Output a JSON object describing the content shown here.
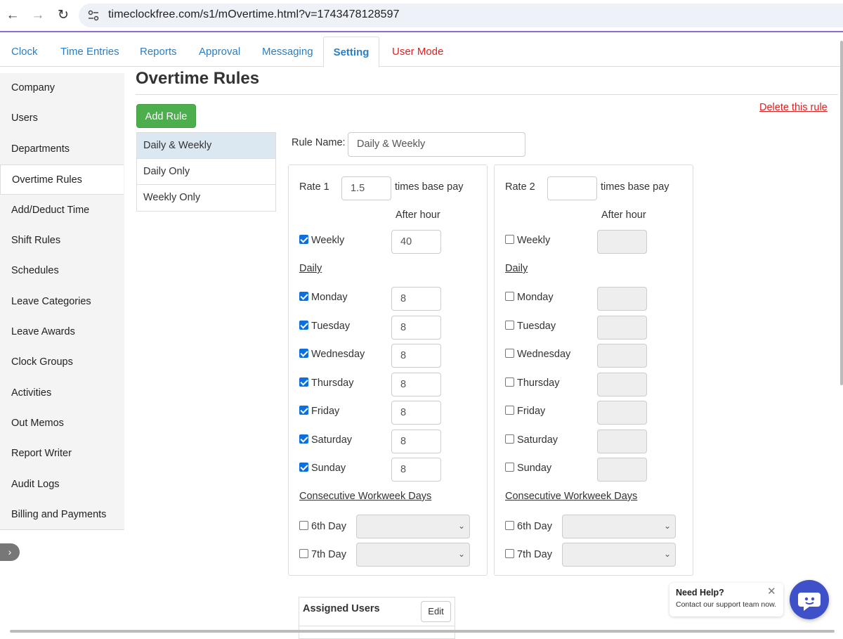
{
  "browser": {
    "url": "timeclockfree.com/s1/mOvertime.html?v=1743478128597"
  },
  "tabs": [
    "Clock",
    "Time Entries",
    "Reports",
    "Approval",
    "Messaging",
    "Setting",
    "User Mode"
  ],
  "sidebar": {
    "items": [
      "Company",
      "Users",
      "Departments",
      "Overtime Rules",
      "Add/Deduct Time",
      "Shift Rules",
      "Schedules",
      "Leave Categories",
      "Leave Awards",
      "Clock Groups",
      "Activities",
      "Out Memos",
      "Report Writer",
      "Audit Logs",
      "Billing and Payments"
    ],
    "active": "Overtime Rules"
  },
  "main": {
    "title": "Overtime Rules",
    "add_rule": "Add Rule",
    "delete_rule": "Delete this rule",
    "rules": [
      "Daily & Weekly",
      "Daily Only",
      "Weekly Only"
    ],
    "rule_name_label": "Rule Name:",
    "rule_name_value": "Daily & Weekly"
  },
  "rate1": {
    "label": "Rate 1",
    "value": "1.5",
    "times": "times base pay",
    "after_hour": "After hour",
    "weekly_label": "Weekly",
    "weekly_checked": true,
    "weekly_hours": "40",
    "daily_head": "Daily",
    "days": [
      {
        "label": "Monday",
        "checked": true,
        "hours": "8"
      },
      {
        "label": "Tuesday",
        "checked": true,
        "hours": "8"
      },
      {
        "label": "Wednesday",
        "checked": true,
        "hours": "8"
      },
      {
        "label": "Thursday",
        "checked": true,
        "hours": "8"
      },
      {
        "label": "Friday",
        "checked": true,
        "hours": "8"
      },
      {
        "label": "Saturday",
        "checked": true,
        "hours": "8"
      },
      {
        "label": "Sunday",
        "checked": true,
        "hours": "8"
      }
    ],
    "consec_head": "Consecutive Workweek Days",
    "day6": "6th Day",
    "day7": "7th Day"
  },
  "rate2": {
    "label": "Rate 2",
    "value": "",
    "times": "times base pay",
    "after_hour": "After hour",
    "weekly_label": "Weekly",
    "weekly_checked": false,
    "weekly_hours": "",
    "daily_head": "Daily",
    "days": [
      {
        "label": "Monday",
        "checked": false,
        "hours": ""
      },
      {
        "label": "Tuesday",
        "checked": false,
        "hours": ""
      },
      {
        "label": "Wednesday",
        "checked": false,
        "hours": ""
      },
      {
        "label": "Thursday",
        "checked": false,
        "hours": ""
      },
      {
        "label": "Friday",
        "checked": false,
        "hours": ""
      },
      {
        "label": "Saturday",
        "checked": false,
        "hours": ""
      },
      {
        "label": "Sunday",
        "checked": false,
        "hours": ""
      }
    ],
    "consec_head": "Consecutive Workweek Days",
    "day6": "6th Day",
    "day7": "7th Day"
  },
  "assigned": {
    "title": "Assigned Users",
    "edit": "Edit"
  },
  "help": {
    "title": "Need Help?",
    "subtitle": "Contact our support team now."
  },
  "colors": {
    "accent": "#2a7ec4",
    "danger": "#e02020",
    "success": "#4cae4c",
    "checkbox": "#0b6fde",
    "chat": "#3f51c8"
  }
}
